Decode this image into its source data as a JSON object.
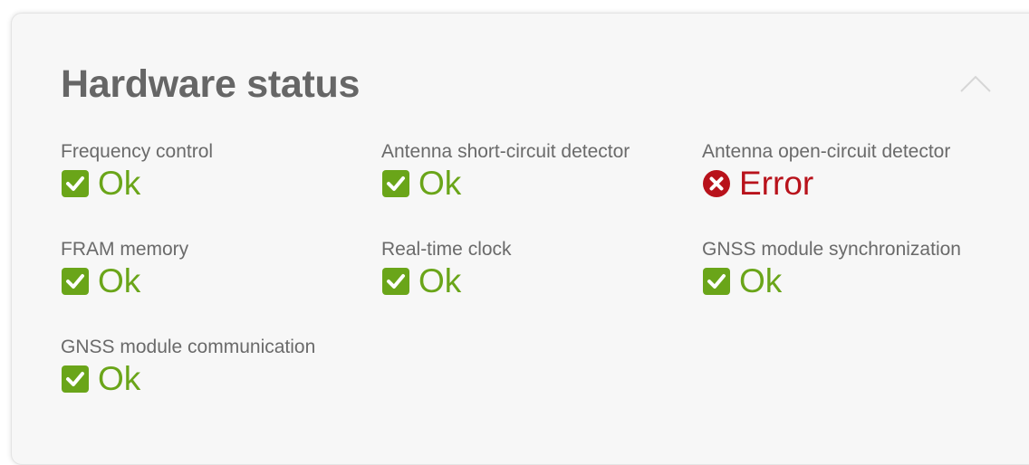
{
  "panel": {
    "title": "Hardware status",
    "collapse_icon": "chevron-up-icon"
  },
  "colors": {
    "ok": "#6aa519",
    "error": "#b8121b",
    "label": "#6a6a6a",
    "title": "#666666"
  },
  "items": [
    {
      "label": "Frequency control",
      "status": "Ok",
      "state": "ok",
      "icon": "checkbox-checked-icon"
    },
    {
      "label": "Antenna short-circuit detector",
      "status": "Ok",
      "state": "ok",
      "icon": "checkbox-checked-icon"
    },
    {
      "label": "Antenna open-circuit detector",
      "status": "Error",
      "state": "error",
      "icon": "error-circle-icon"
    },
    {
      "label": "FRAM memory",
      "status": "Ok",
      "state": "ok",
      "icon": "checkbox-checked-icon"
    },
    {
      "label": "Real-time clock",
      "status": "Ok",
      "state": "ok",
      "icon": "checkbox-checked-icon"
    },
    {
      "label": "GNSS module synchronization",
      "status": "Ok",
      "state": "ok",
      "icon": "checkbox-checked-icon"
    },
    {
      "label": "GNSS module communication",
      "status": "Ok",
      "state": "ok",
      "icon": "checkbox-checked-icon"
    }
  ]
}
